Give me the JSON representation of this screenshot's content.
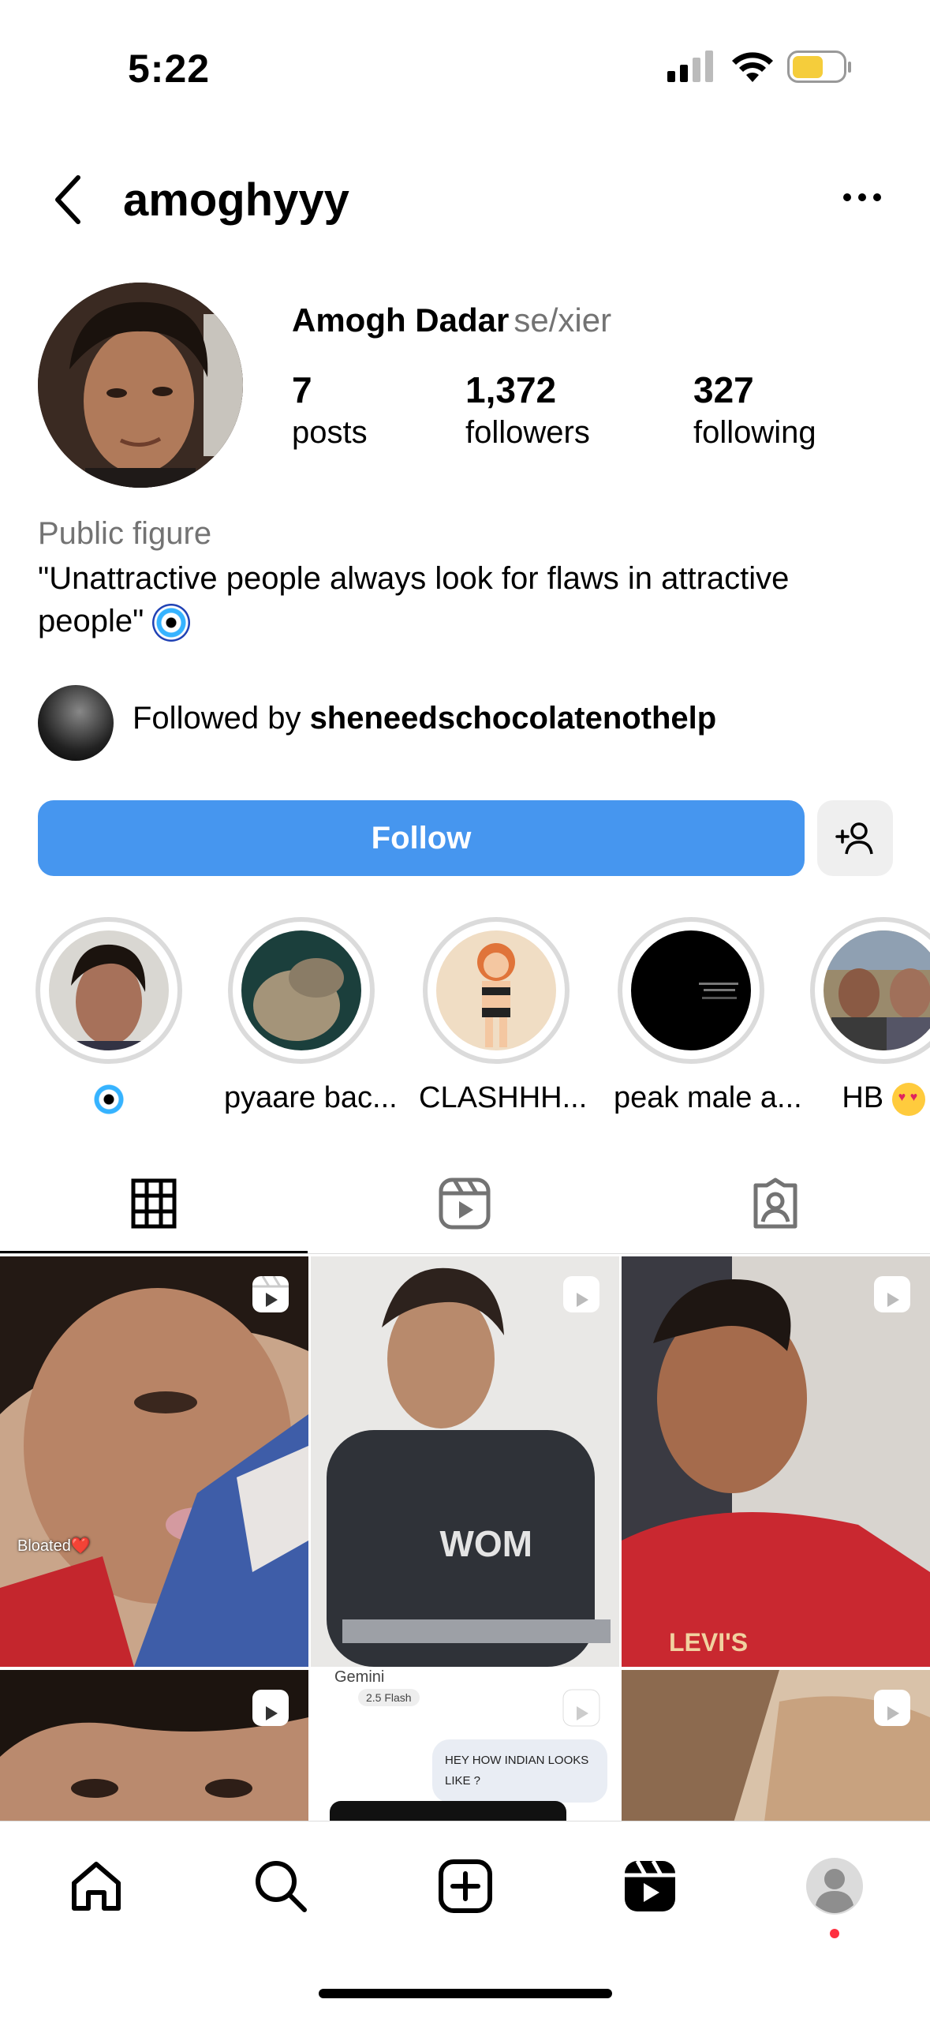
{
  "status_bar": {
    "time": "5:22"
  },
  "header": {
    "username": "amoghyyy"
  },
  "profile": {
    "name": "Amogh Dadar",
    "pronouns": "se/xier",
    "stats": [
      {
        "count": "7",
        "label": "posts"
      },
      {
        "count": "1,372",
        "label": "followers"
      },
      {
        "count": "327",
        "label": "following"
      }
    ],
    "category": "Public figure",
    "bio": "\"Unattractive people always look for flaws in attractive people\"",
    "followed_by_prefix": "Followed by ",
    "followed_by_user": "sheneedschocolatenothelp"
  },
  "actions": {
    "follow_label": "Follow"
  },
  "highlights": [
    {
      "label": ""
    },
    {
      "label": "pyaare bac..."
    },
    {
      "label": "CLASHHH..."
    },
    {
      "label": "peak male a..."
    },
    {
      "label": "HB"
    }
  ],
  "grid": {
    "captions": {
      "post1": "Bloated❤️"
    },
    "gemini_post": {
      "app": "Gemini",
      "model": "2.5 Flash",
      "message": "HEY HOW INDIAN LOOKS LIKE ?"
    }
  },
  "colors": {
    "accent": "#4696ef",
    "notification": "#ff3040"
  }
}
